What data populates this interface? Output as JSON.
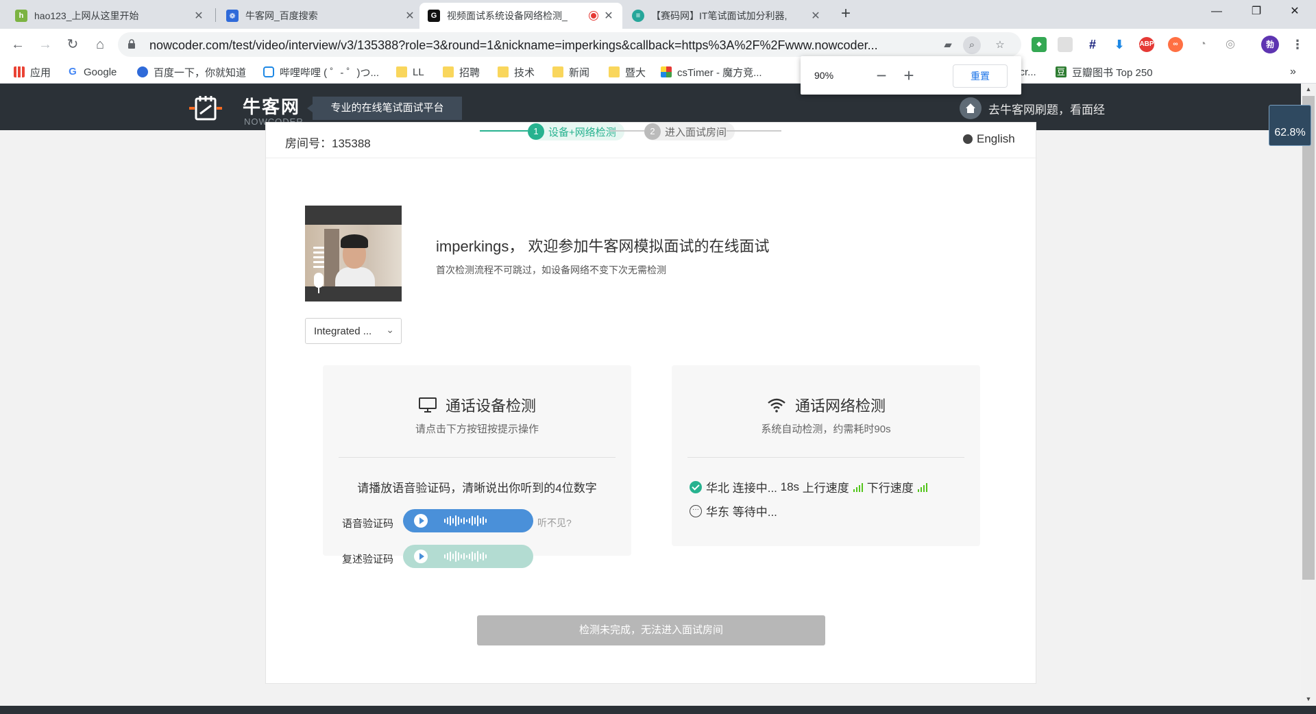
{
  "browser": {
    "tabs": [
      {
        "title": "hao123_上网从这里开始"
      },
      {
        "title": "牛客网_百度搜索"
      },
      {
        "title": "视频面试系统设备网络检测_"
      },
      {
        "title": "【赛码网】IT笔试面试加分利器,"
      }
    ],
    "url": "nowcoder.com/test/video/interview/v3/135388?role=3&round=1&nickname=imperkings&callback=https%3A%2F%2Fwww.nowcoder...",
    "profile_initial": "勃",
    "bookmarks": [
      {
        "label": "应用"
      },
      {
        "label": "Google"
      },
      {
        "label": "百度一下，你就知道"
      },
      {
        "label": "哔哩哔哩 ( ゜- ゜)つ..."
      },
      {
        "label": "LL"
      },
      {
        "label": "招聘"
      },
      {
        "label": "技术"
      },
      {
        "label": "新闻"
      },
      {
        "label": "暨大"
      },
      {
        "label": "csTimer - 魔方竞..."
      },
      {
        "label": "scr..."
      },
      {
        "label": "豆瓣图书 Top 250"
      }
    ],
    "zoom_popup": {
      "level": "90%",
      "reset_label": "重置"
    },
    "page_zoom_badge": "62.8%"
  },
  "site": {
    "logo_cn": "牛客网",
    "logo_en": "NOWCODER",
    "slogan": "专业的在线笔试面试平台",
    "home_link": "去牛客网刷题，看面经"
  },
  "room": {
    "label": "房间号：",
    "number": "135388"
  },
  "steps": [
    {
      "num": "1",
      "label": "设备+网络检测",
      "state": "active"
    },
    {
      "num": "2",
      "label": "进入面试房间",
      "state": "pending"
    }
  ],
  "language_toggle": "English",
  "device_select": {
    "value": "Integrated ..."
  },
  "welcome": {
    "title": "imperkings， 欢迎参加牛客网模拟面试的在线面试",
    "subtitle": "首次检测流程不可跳过，如设备网络不变下次无需检测"
  },
  "device_panel": {
    "title": "通话设备检测",
    "subtitle": "请点击下方按钮按提示操作",
    "instruction": "请播放语音验证码，清晰说出你听到的4位数字",
    "voice_code_label": "语音验证码",
    "cant_hear": "听不见?",
    "repeat_code_label": "复述验证码"
  },
  "network_panel": {
    "title": "通话网络检测",
    "subtitle": "系统自动检测，约需耗时90s",
    "rows": [
      {
        "region": "华北",
        "status": "连接中...",
        "time": "18s",
        "up_label": "上行速度",
        "down_label": "下行速度",
        "state": "connecting"
      },
      {
        "region": "华东",
        "status": "等待中...",
        "state": "waiting"
      }
    ]
  },
  "enter_button": "检测未完成，无法进入面试房间",
  "colors": {
    "accent_green": "#27b28f",
    "audio_blue": "#4a90d9",
    "audio_disabled": "#b3dcd2",
    "header_dark": "#2b3137"
  }
}
